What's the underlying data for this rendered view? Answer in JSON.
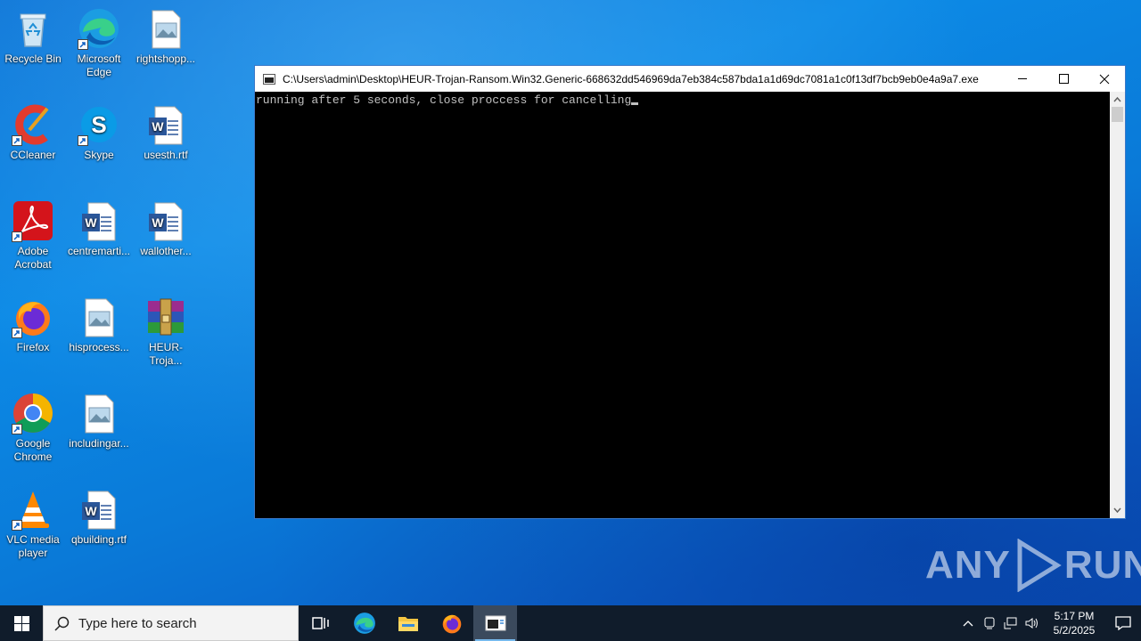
{
  "desktop": {
    "icons": [
      {
        "label": "Recycle Bin",
        "icon": "recycle-bin-icon"
      },
      {
        "label": "Microsoft Edge",
        "icon": "edge-icon"
      },
      {
        "label": "rightshopp...",
        "icon": "image-file-icon"
      },
      {
        "label": "CCleaner",
        "icon": "ccleaner-icon"
      },
      {
        "label": "Skype",
        "icon": "skype-icon"
      },
      {
        "label": "usesth.rtf",
        "icon": "word-doc-icon"
      },
      {
        "label": "Adobe Acrobat",
        "icon": "acrobat-icon"
      },
      {
        "label": "centremarti...",
        "icon": "word-doc-icon"
      },
      {
        "label": "wallother...",
        "icon": "word-doc-icon"
      },
      {
        "label": "Firefox",
        "icon": "firefox-icon"
      },
      {
        "label": "hisprocess...",
        "icon": "image-file-icon"
      },
      {
        "label": "HEUR-Troja...",
        "icon": "winrar-icon"
      },
      {
        "label": "Google Chrome",
        "icon": "chrome-icon"
      },
      {
        "label": "includingar...",
        "icon": "image-file-icon"
      },
      {
        "label": "VLC media player",
        "icon": "vlc-icon"
      },
      {
        "label": "qbuilding.rtf",
        "icon": "word-doc-icon"
      }
    ]
  },
  "console_window": {
    "title": "C:\\Users\\admin\\Desktop\\HEUR-Trojan-Ransom.Win32.Generic-668632dd546969da7eb384c587bda1a1d69dc7081a1c0f13df7bcb9eb0e4a9a7.exe",
    "output": "running after 5 seconds, close proccess for cancelling"
  },
  "watermark": {
    "text_left": "ANY",
    "text_right": "RUN"
  },
  "taskbar": {
    "search_placeholder": "Type here to search",
    "time": "5:17 PM",
    "date": "5/2/2025"
  },
  "colors": {
    "accent": "#0078d7",
    "taskbar_bg": "#101c2b",
    "console_bg": "#000000"
  }
}
